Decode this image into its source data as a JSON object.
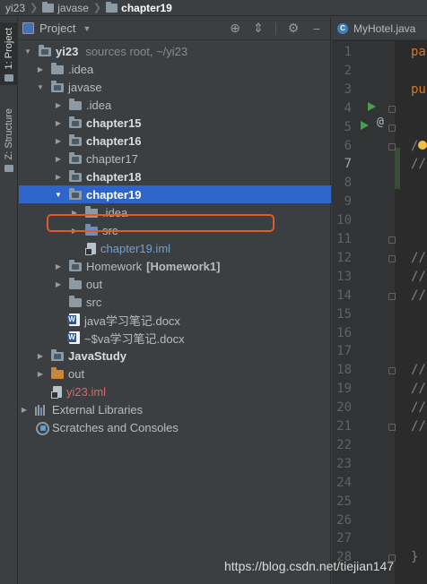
{
  "breadcrumb": {
    "items": [
      "yi23",
      "javase",
      "chapter19"
    ]
  },
  "toolstrip": {
    "project_tab": "1: Project",
    "structure_tab": "Z: Structure"
  },
  "panel": {
    "selector_label": "Project",
    "tools": {
      "locate_icon": "crosshair-icon",
      "collapse_icon": "collapse-all-icon",
      "settings_icon": "gear-icon",
      "hide_icon": "minimize-icon"
    }
  },
  "tree": {
    "root": {
      "name": "yi23",
      "extra": "sources root,  ~/yi23"
    },
    "idea_root": ".idea",
    "javase": ".javase",
    "javase_label": "javase",
    "idea_javase": ".idea",
    "chapter15": "chapter15",
    "chapter16": "chapter16",
    "chapter17": "chapter17",
    "chapter18": "chapter18",
    "chapter19": "chapter19",
    "idea_ch19": ".idea",
    "src_ch19": "src",
    "iml_ch19": "chapter19.iml",
    "homework": "Homework",
    "homework_tag": "[Homework1]",
    "out_javase": "out",
    "src_javase": "src",
    "doc1": "java学习笔记.docx",
    "doc2": "~$va学习笔记.docx",
    "javastudy": "JavaStudy",
    "out_root": "out",
    "yi23_iml": "yi23.iml",
    "external_libraries": "External Libraries",
    "scratches": "Scratches and Consoles"
  },
  "editor": {
    "tab_label": "MyHotel.java",
    "current_line": 7,
    "line_numbers": [
      "1",
      "2",
      "3",
      "4",
      "5",
      "6",
      "7",
      "8",
      "9",
      "10",
      "11",
      "12",
      "13",
      "14",
      "15",
      "16",
      "17",
      "18",
      "19",
      "20",
      "21",
      "22",
      "23",
      "24",
      "25",
      "26",
      "27",
      "28"
    ],
    "code_fragments": {
      "line1": "pa",
      "line3": "pu",
      "line6": "/",
      "line7": "//",
      "line12": "//",
      "line13": "//",
      "line14": "//",
      "line18": "//",
      "line19": "//",
      "line20": "//",
      "line21": "//",
      "line28": "}"
    }
  },
  "watermark": "https://blog.csdn.net/tiejian147",
  "colors": {
    "selection": "#2f65ca",
    "highlight_box": "#e05a2a",
    "panel_bg": "#3c3f41",
    "editor_bg": "#2b2b2b",
    "gutter_bg": "#313335"
  }
}
